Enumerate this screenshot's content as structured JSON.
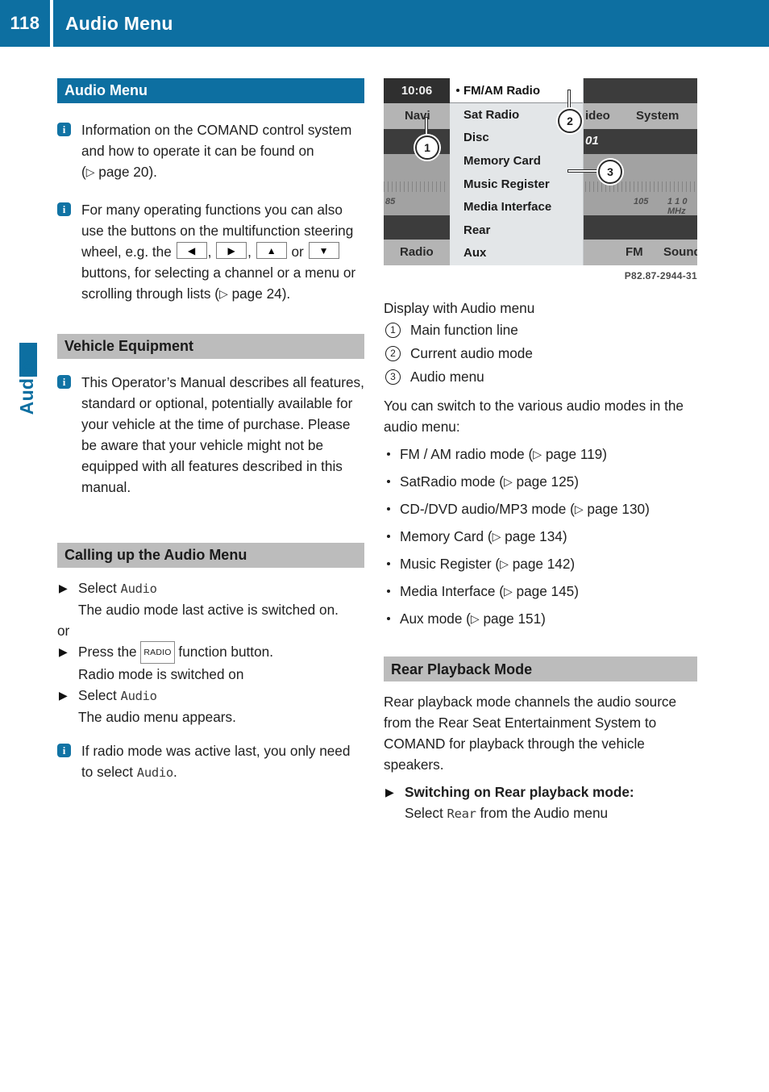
{
  "header": {
    "page_number": "118",
    "title": "Audio Menu",
    "accent_color": "#0d6fa1"
  },
  "side_tab": {
    "label": "Audio"
  },
  "left_column": {
    "section1": {
      "heading": "Audio Menu",
      "note1_text": "Information on the COMAND control system and how to operate it can be found on (",
      "note1_ref": "page 20",
      "note1_tail": ").",
      "note2_part1": "For many operating functions you can also use the buttons on the multifunction steering wheel, e.g. the ",
      "note2_keys": [
        "left-arrow",
        "right-arrow",
        "up-arrow",
        "down-arrow"
      ],
      "note2_part2": ", ",
      "note2_part3": " or ",
      "note2_part4": " buttons, for selecting a channel or a menu or scrolling through lists (",
      "note2_ref": "page 24",
      "note2_tail": ")."
    },
    "section2": {
      "heading": "Vehicle Equipment",
      "note_text": "This Operator’s Manual describes all features, standard or optional, potentially available for your vehicle at the time of purchase. Please be aware that your vehicle might not be equipped with all features described in this manual."
    },
    "section3": {
      "heading": "Calling up the Audio Menu",
      "step1_label": "Select ",
      "step1_token": "Audio",
      "step1_result": "The audio mode last active is switched on.",
      "or_text": "or",
      "step2_pre": "Press the ",
      "step2_key": "RADIO",
      "step2_post": " function button.",
      "step2_result": "Radio mode is switched on",
      "step3_label": "Select ",
      "step3_token": "Audio",
      "step3_result": "The audio menu appears.",
      "note_pre": "If radio mode was active last, you only need to select ",
      "note_token": "Audio",
      "note_post": "."
    }
  },
  "right_column": {
    "figure": {
      "time": "10:06",
      "left_buttons": [
        "Navi",
        "Radio"
      ],
      "right_buttons": [
        "ideo",
        "System",
        "FM",
        "Sound"
      ],
      "partial_station": "01",
      "menu_items": [
        "FM/AM Radio",
        "Sat Radio",
        "Disc",
        "Memory Card",
        "Music Register",
        "Media Interface",
        "Rear",
        "Aux"
      ],
      "scale_labels_left": [
        "85"
      ],
      "scale_labels_right": [
        "105",
        "1 1 0 MHz"
      ],
      "callouts": [
        "1",
        "2",
        "3"
      ],
      "figure_id": "P82.87-2944-31"
    },
    "caption": "Display with Audio menu",
    "legend": [
      {
        "num": "1",
        "text": "Main function line"
      },
      {
        "num": "2",
        "text": "Current audio mode"
      },
      {
        "num": "3",
        "text": "Audio menu"
      }
    ],
    "intro": "You can switch to the various audio modes in the audio menu:",
    "modes": [
      {
        "label": "FM / AM radio mode (",
        "ref": "page 119",
        "tail": ")"
      },
      {
        "label": "SatRadio mode (",
        "ref": "page 125",
        "tail": ")"
      },
      {
        "label": "CD-/DVD audio/MP3 mode (",
        "ref": "page 130",
        "tail": ")"
      },
      {
        "label": "Memory Card (",
        "ref": "page 134",
        "tail": ")"
      },
      {
        "label": "Music Register (",
        "ref": "page 142",
        "tail": ")"
      },
      {
        "label": "Media Interface (",
        "ref": "page 145",
        "tail": ")"
      },
      {
        "label": "Aux mode (",
        "ref": "page 151",
        "tail": ")"
      }
    ],
    "rear_section": {
      "heading": "Rear Playback Mode",
      "body": "Rear playback mode channels the audio source from the Rear Seat Entertainment System to COMAND for playback through the vehicle speakers.",
      "step_bold": "Switching on Rear playback mode:",
      "step_pre": "Select ",
      "step_token": "Rear",
      "step_post": " from the Audio menu"
    }
  }
}
